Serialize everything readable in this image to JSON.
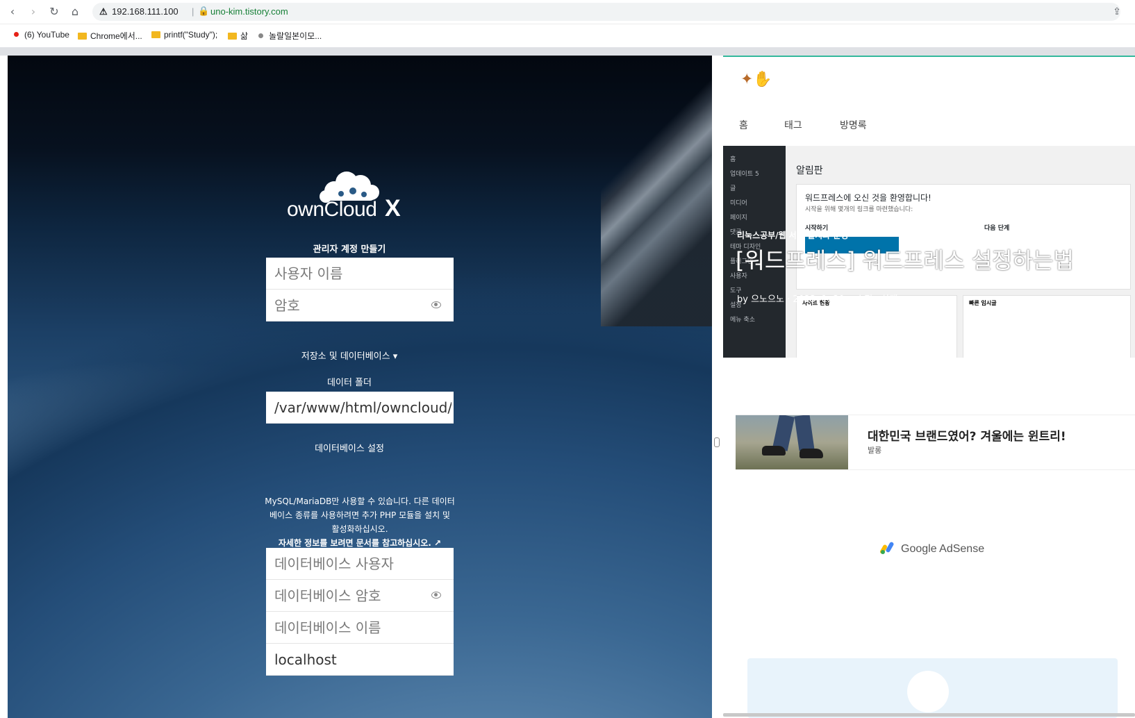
{
  "browser": {
    "nav": {
      "back": "‹",
      "forward": "›",
      "reload": "↻",
      "home": "⌂"
    },
    "address_ip": "192.168.111.100",
    "address_separator": "|",
    "address_url": "uno-kim.tistory.com",
    "share_icon": "⇪"
  },
  "bookmarks": [
    {
      "label": "(6) YouTube",
      "icon": "youtube-dot-icon"
    },
    {
      "label": "Chrome에서...",
      "icon": "folder-icon"
    },
    {
      "label": "printf(\"Study\");",
      "icon": "folder-icon"
    },
    {
      "label": "삶",
      "icon": "folder-icon"
    },
    {
      "label": "놀랄일본이모...",
      "icon": "globe-dot-icon"
    }
  ],
  "owncloud": {
    "logo_text": "ownCloud",
    "logo_x": "X",
    "admin_title": "관리자 계정 만들기",
    "username_placeholder": "사용자 이름",
    "password_placeholder": "암호",
    "storage_label": "저장소 및 데이터베이스 ▾",
    "data_folder_label": "데이터 폴더",
    "data_folder_value": "/var/www/html/owncloud/data",
    "db_settings_label": "데이터베이스 설정",
    "db_info_line1": "MySQL/MariaDB만 사용할 수 있습니다. 다른 데이터베이스 종류를 사용하려면 추가 PHP 모듈을 설치 및 활성화하십시오.",
    "db_info_link": "자세한 정보를 보려면 문서를 참고하십시오. ↗",
    "db_user_placeholder": "데이터베이스 사용자",
    "db_password_placeholder": "데이터베이스 암호",
    "db_name_placeholder": "데이터베이스 이름",
    "db_host_value": "localhost"
  },
  "blog": {
    "nav": [
      "홈",
      "태그",
      "방명록"
    ],
    "hero_category": "리눅스공부/웹 서버 설치와 운영",
    "hero_title": "[워드프레스] 워드프레스 설정하는법",
    "hero_meta": "by 으노으노 · 2023. 1. 30. · 수정 · 삭제",
    "wp_sidebar": [
      "홈",
      "업데이트 5",
      "글",
      "미디어",
      "페이지",
      "댓글",
      "테마 디자인",
      "플러그인",
      "사용자",
      "도구",
      "설정",
      "메뉴 축소"
    ],
    "wp_title": "알림판",
    "wp_welcome": "워드프레스에 오신 것을 환영합니다!",
    "wp_welcome_sub": "시작을 위해 몇개의 링크를 마련했습니다:",
    "wp_start": "시작하기",
    "wp_next": "다음 단계",
    "wp_panel_left": "사이트 현황",
    "wp_panel_right": "빠른 임시글",
    "card_title": "대한민국 브랜드였어? 겨울에는 윈트리!",
    "card_sub": "발롱",
    "adsense_label": "Google AdSense"
  }
}
